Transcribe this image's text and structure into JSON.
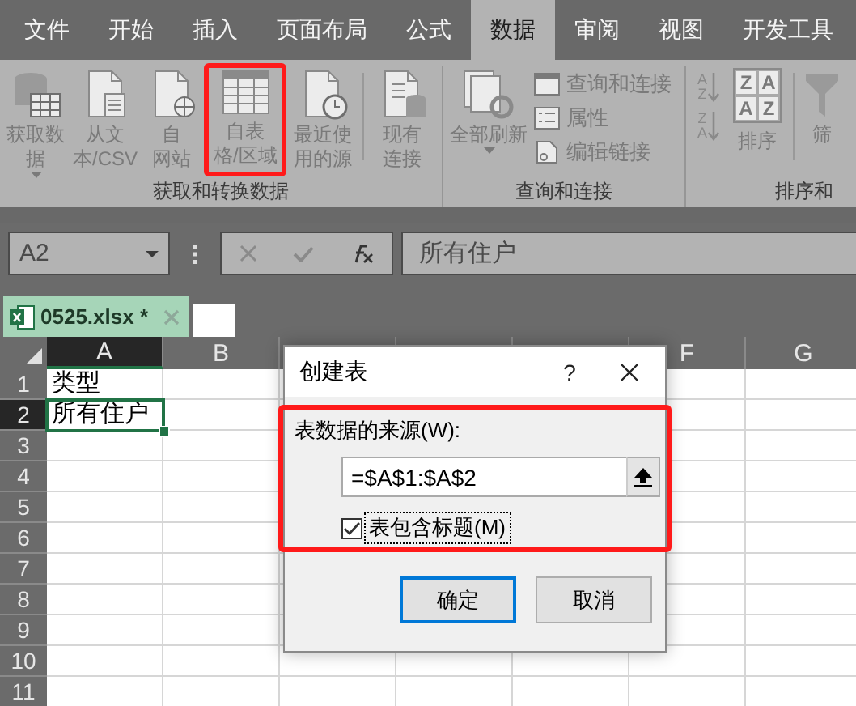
{
  "tabs": [
    {
      "label": "文件",
      "selected": false
    },
    {
      "label": "开始",
      "selected": false
    },
    {
      "label": "插入",
      "selected": false
    },
    {
      "label": "页面布局",
      "selected": false
    },
    {
      "label": "公式",
      "selected": false
    },
    {
      "label": "数据",
      "selected": true
    },
    {
      "label": "审阅",
      "selected": false
    },
    {
      "label": "视图",
      "selected": false
    },
    {
      "label": "开发工具",
      "selected": false
    }
  ],
  "ribbon": {
    "groups": [
      {
        "label": "获取和转换数据",
        "items": [
          {
            "kind": "large",
            "lines": [
              "获取数",
              "据"
            ],
            "dropdown": true
          },
          {
            "kind": "large",
            "lines": [
              "从文",
              "本/CSV"
            ],
            "dropdown": false
          },
          {
            "kind": "large",
            "lines": [
              "自",
              "网站"
            ],
            "dropdown": false
          },
          {
            "kind": "large",
            "lines": [
              "自表",
              "格/区域"
            ],
            "dropdown": false,
            "highlighted": true
          },
          {
            "kind": "large",
            "lines": [
              "最近使",
              "用的源"
            ],
            "dropdown": false
          },
          {
            "kind": "separator"
          },
          {
            "kind": "large",
            "lines": [
              "现有",
              "连接"
            ],
            "dropdown": false
          }
        ]
      },
      {
        "label": "查询和连接",
        "items": [
          {
            "kind": "large",
            "lines": [
              "全部刷新"
            ],
            "dropdown": true
          },
          {
            "kind": "smalls",
            "entries": [
              "查询和连接",
              "属性",
              "编辑链接"
            ]
          }
        ]
      },
      {
        "label": "排序和",
        "items": [
          {
            "kind": "sorts",
            "entries": [
              [
                "A",
                "Z"
              ],
              [
                "Z",
                "A"
              ]
            ]
          },
          {
            "kind": "grid",
            "letters": [
              "Z",
              "A",
              "A",
              "Z"
            ],
            "lines": [
              "排序"
            ]
          },
          {
            "kind": "separator"
          },
          {
            "kind": "large",
            "lines": [
              "筛"
            ],
            "dropdown": false
          }
        ]
      }
    ]
  },
  "formula_bar": {
    "name_box": "A2",
    "value": "所有住户"
  },
  "workbook_tab": {
    "title": "0525.xlsx *"
  },
  "sheet": {
    "columns": [
      {
        "label": "A",
        "selected": true
      },
      {
        "label": "B",
        "selected": false
      },
      {
        "selected": false
      },
      {
        "selected": false
      },
      {
        "selected": false
      },
      {
        "label": "F",
        "selected": false
      },
      {
        "label": "G",
        "selected": false
      }
    ],
    "rows": [
      {
        "number": "1",
        "selected": false,
        "cells": [
          {
            "text": "类型",
            "active": false
          }
        ]
      },
      {
        "number": "2",
        "selected": true,
        "cells": [
          {
            "text": "所有住户",
            "active": true
          }
        ]
      },
      {
        "number": "3",
        "selected": false
      },
      {
        "number": "4",
        "selected": false
      },
      {
        "number": "5",
        "selected": false
      },
      {
        "number": "6",
        "selected": false
      },
      {
        "number": "7",
        "selected": false
      },
      {
        "number": "8",
        "selected": false
      },
      {
        "number": "9",
        "selected": false
      },
      {
        "number": "10",
        "selected": false
      },
      {
        "number": "11",
        "selected": false
      }
    ]
  },
  "dialog": {
    "title": "创建表",
    "help": "?",
    "source_highlighted": true,
    "source_label": "表数据的来源(W):",
    "source_value": "=$A$1:$A$2",
    "header_checkbox": {
      "label": "表包含标题(M)",
      "checked": true
    },
    "buttons": [
      {
        "label": "确定",
        "default": true
      },
      {
        "label": "取消",
        "default": false
      }
    ]
  }
}
